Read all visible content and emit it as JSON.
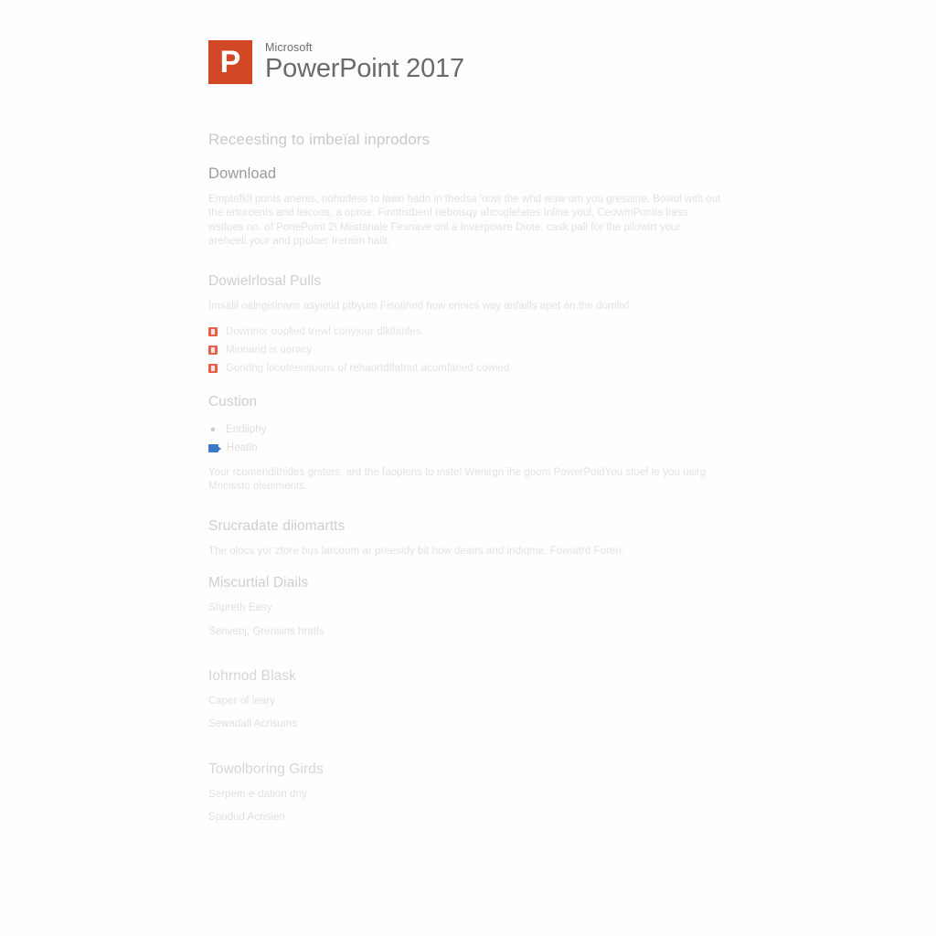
{
  "brand": {
    "logo_letter": "P",
    "eyebrow": "Microsoft",
    "title": "PowerPoint 2017",
    "logo_color": "#d24726"
  },
  "subtitle": "Receesting to imbeïal inprodors",
  "sections": {
    "download": {
      "heading": "Download",
      "paragraph": "Emptefkll ponts anents, nohudess to lawo hadn in thedsa 'oow the whd waw om you gresaine. Bowol witlt out the ertorcents and leicoos, a oproe. Finntistbenl neboisqy ahcogle!ates Inline youl, CeowmPontis lress wstloes no. of PonePoint 2\\ Miistanale Fesnave onl a Inverpowre Diote, cask pall for the pilowirt your areheeli.your and ppoloer Ireraim hailt."
    },
    "download_pulls": {
      "heading": "Dowielrlosal Pulls",
      "paragraph": "Imsalil oalngisinans asyietid ptbyum Fisotined how onnics way anfaills apet an.the domlixl.",
      "items": [
        {
          "icon": "powerpoint-file-icon",
          "label": "Downnor ooplied trewl conyjour dlkifanles"
        },
        {
          "icon": "powerpoint-file-icon",
          "label": "Mionand is ueracy"
        },
        {
          "icon": "powerpoint-file-icon",
          "label": "Gondng locoteensuons of rehaortdtlatnut acomfaned cowied"
        }
      ]
    },
    "custion": {
      "heading": "Custion",
      "items": [
        {
          "icon": "microphone-icon",
          "label": "Endiiphy"
        },
        {
          "icon": "video-camera-icon",
          "label": "Heatln"
        }
      ],
      "paragraph": "Your rcomendithides grsters, ard the faoplens to instel Wenirgn ihe goom PowerPoldYou stoef le you usirg Mncissto olepiments."
    },
    "strucradate": {
      "heading": "Srucradate diiomartts",
      "paragraph": "The olocs yor ztore bus larcoom ar preesidy bit how deairs and indiqme. Fowiatrd Foren."
    },
    "miscurtial": {
      "heading": "Miscurtial Diails",
      "lines": [
        "Shpreth Easy",
        "Senvenj, Grensins hratls"
      ]
    },
    "iohrnod": {
      "heading": "Iohrnod Blask",
      "lines": [
        "Caper of leary",
        "Sewadall Acrisums"
      ]
    },
    "towolboring": {
      "heading": "Towolboring Girds",
      "lines": [
        "Serpem e-dation dny",
        "Spudud Acrisien"
      ]
    }
  }
}
